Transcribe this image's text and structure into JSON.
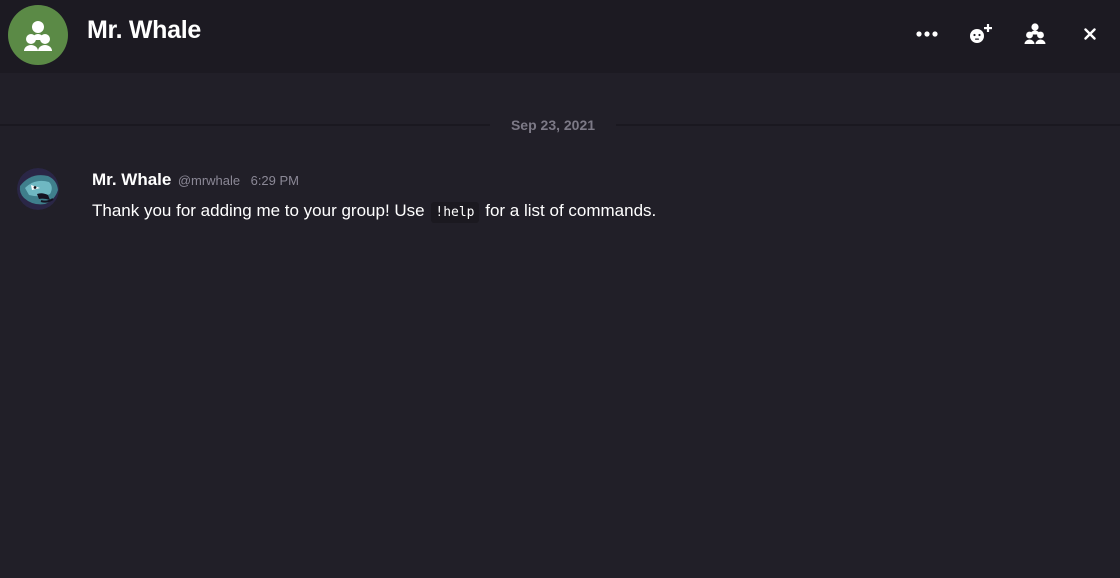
{
  "header": {
    "title": "Mr. Whale",
    "avatar_color": "#5b8a46",
    "avatar_icon": "group-icon",
    "actions": [
      {
        "icon": "more-options-icon"
      },
      {
        "icon": "add-friend-icon"
      },
      {
        "icon": "group-members-icon"
      },
      {
        "icon": "close-icon"
      }
    ]
  },
  "divider": {
    "date": "Sep 23, 2021"
  },
  "messages": [
    {
      "author": "Mr. Whale",
      "handle": "@mrwhale",
      "time": "6:29 PM",
      "avatar_icon": "whale-avatar",
      "text_before": "Thank you for adding me to your group! Use",
      "code": "!help",
      "text_after": "for a list of commands."
    }
  ],
  "colors": {
    "background": "#211f28",
    "header_background": "#1c1a22",
    "text": "#ffffff",
    "muted_text": "#8b8896"
  }
}
